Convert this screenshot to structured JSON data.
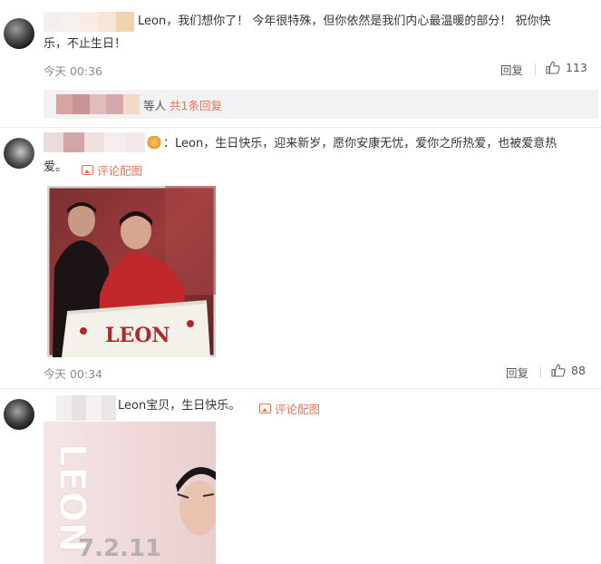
{
  "comments": [
    {
      "text_line1": "Leon，我们想你了！ 今年很特殊，但你依然是我们内心最温暖的部分！ 祝你快",
      "text_line2": "乐，不止生日！",
      "time": "今天 00:36",
      "reply_label": "回复",
      "like_count": "113",
      "replies": {
        "label": "等人",
        "link": "共1条回复"
      }
    },
    {
      "text_line1": "：Leon，生日快乐，迎来新岁，愿你安康无忧，爱你之所热爱，也被爱意热",
      "text_line2": "爱。",
      "pic_link": "评论配图",
      "cake_text": "LEON",
      "time": "今天 00:34",
      "reply_label": "回复",
      "like_count": "88"
    },
    {
      "text_line1": "Leon宝贝，生日快乐。",
      "pic_link": "评论配图",
      "poster_text": "LEON",
      "poster_date": "7.2.11"
    }
  ],
  "icons": {
    "like": "thumbs-up-icon",
    "picture": "image-icon",
    "avatar": "avatar"
  },
  "colors": {
    "link": "#eb7350",
    "meta": "#8a8a8a",
    "reply_bar": "#f2f2f5"
  }
}
